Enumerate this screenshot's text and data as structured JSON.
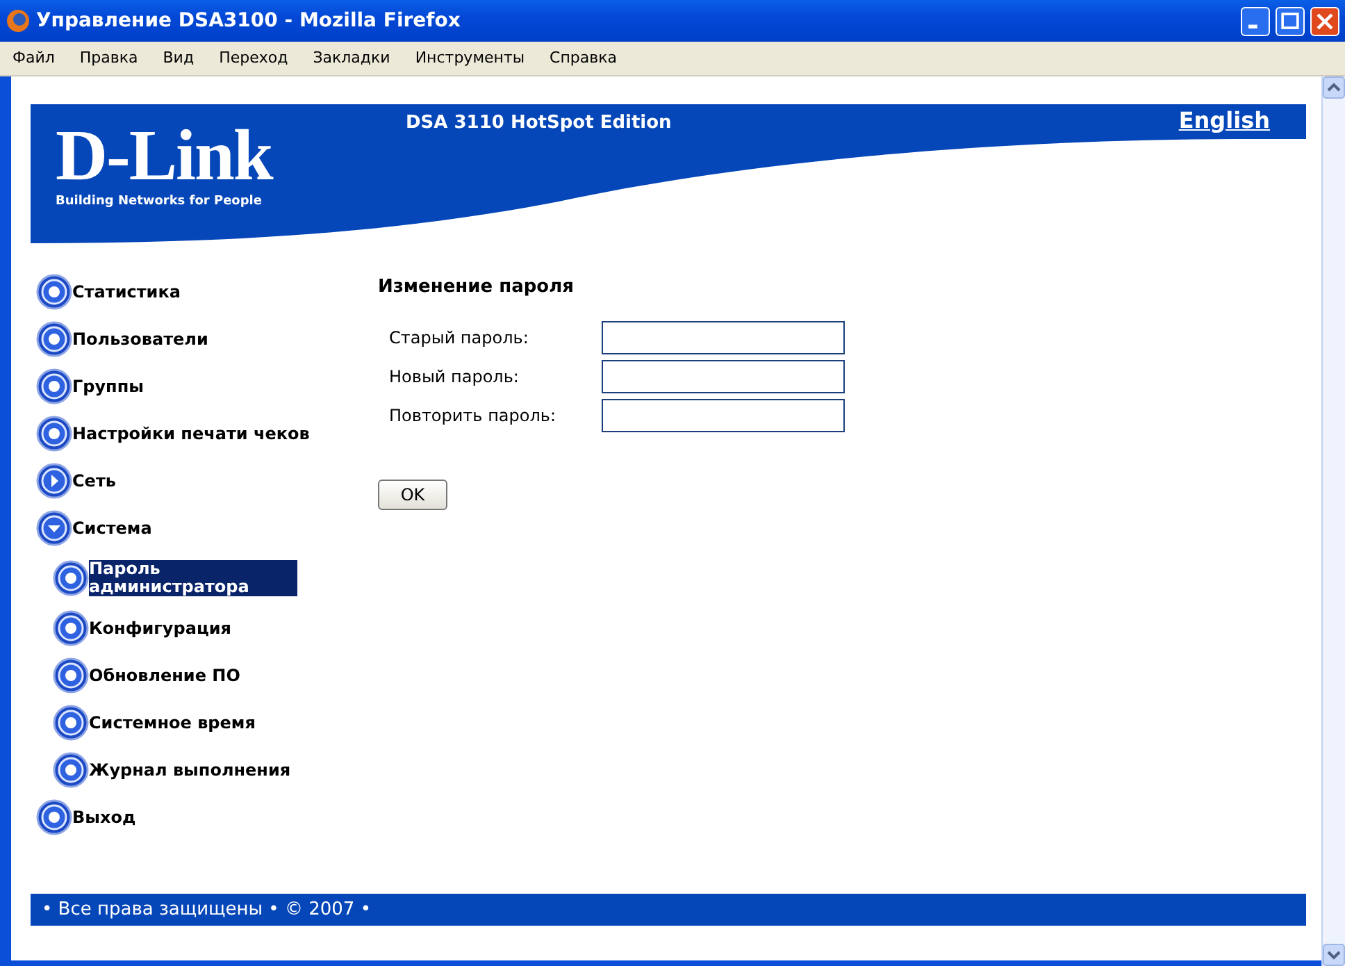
{
  "window": {
    "title": "Управление DSA3100 - Mozilla Firefox"
  },
  "menu": [
    "Файл",
    "Правка",
    "Вид",
    "Переход",
    "Закладки",
    "Инструменты",
    "Справка"
  ],
  "header": {
    "logo": "D-Link",
    "tagline": "Building Networks for People",
    "product": "DSA 3110 HotSpot Edition",
    "language_link": "English"
  },
  "sidebar": {
    "items": [
      {
        "label": "Статистика",
        "selected": false
      },
      {
        "label": "Пользователи",
        "selected": false
      },
      {
        "label": "Группы",
        "selected": false
      },
      {
        "label": "Настройки печати чеков",
        "selected": false
      },
      {
        "label": "Сеть",
        "selected": false,
        "expanded": false
      },
      {
        "label": "Система",
        "selected": false,
        "expanded": true,
        "children": [
          {
            "label": "Пароль администратора",
            "selected": true
          },
          {
            "label": "Конфигурация",
            "selected": false
          },
          {
            "label": "Обновление ПО",
            "selected": false
          },
          {
            "label": "Системное время",
            "selected": false
          },
          {
            "label": "Журнал выполнения",
            "selected": false
          }
        ]
      },
      {
        "label": "Выход",
        "selected": false
      }
    ]
  },
  "form": {
    "title": "Изменение пароля",
    "fields": [
      {
        "label": "Старый пароль:"
      },
      {
        "label": "Новый пароль:"
      },
      {
        "label": "Повторить пароль:"
      }
    ],
    "submit": "OK"
  },
  "footer": "• Все права защищены • © 2007 •"
}
